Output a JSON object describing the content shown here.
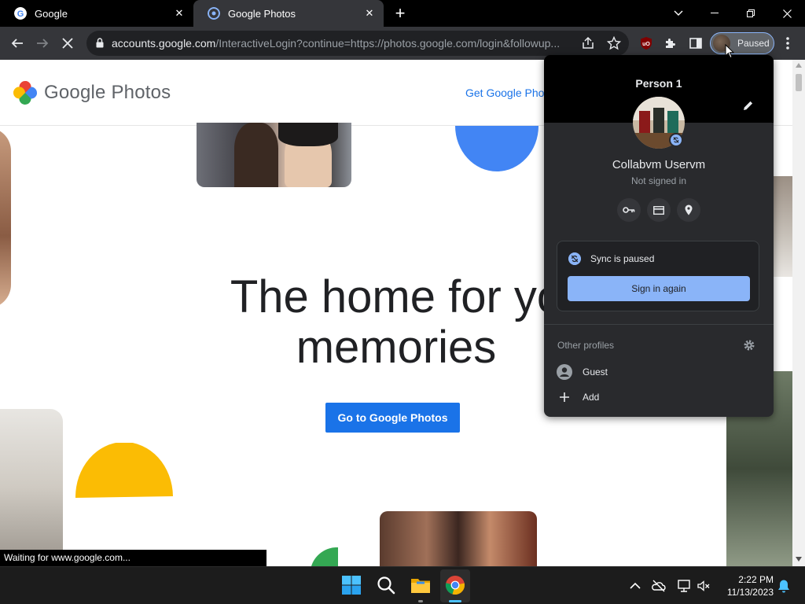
{
  "window": {
    "tabs": [
      {
        "title": "Google",
        "favicon": "google-g-icon"
      },
      {
        "title": "Google Photos",
        "favicon": "google-photos-icon"
      }
    ],
    "controls": [
      "chevron-down-icon",
      "minimize-icon",
      "restore-icon",
      "close-icon"
    ]
  },
  "toolbar": {
    "url_host": "accounts.google.com",
    "url_path": "/InteractiveLogin?continue=https://photos.google.com/login&followup...",
    "profile_label": "Paused"
  },
  "page": {
    "brand": "Google Photos",
    "header_link": "Get Google Pho",
    "hero_line1": "The home for yo",
    "hero_line2": "memories",
    "cta": "Go to Google Photos",
    "status": "Waiting for www.google.com..."
  },
  "profile_menu": {
    "person": "Person 1",
    "account_name": "Collabvm Uservm",
    "account_status": "Not signed in",
    "quick_actions": [
      "key-icon",
      "credit-card-icon",
      "location-pin-icon"
    ],
    "sync_text": "Sync is paused",
    "sign_in_button": "Sign in again",
    "other_profiles_label": "Other profiles",
    "other_profiles": [
      {
        "label": "Guest",
        "icon": "guest-avatar-icon"
      },
      {
        "label": "Add",
        "icon": "plus-icon"
      }
    ]
  },
  "taskbar": {
    "apps": [
      "windows-start-icon",
      "search-icon",
      "file-explorer-icon",
      "chrome-icon"
    ],
    "time": "2:22 PM",
    "date": "11/13/2023"
  },
  "colors": {
    "accent": "#1a73e8",
    "sync_blue": "#8ab4f8",
    "popup_bg": "#292a2d",
    "chrome_toolbar": "#35363a"
  }
}
